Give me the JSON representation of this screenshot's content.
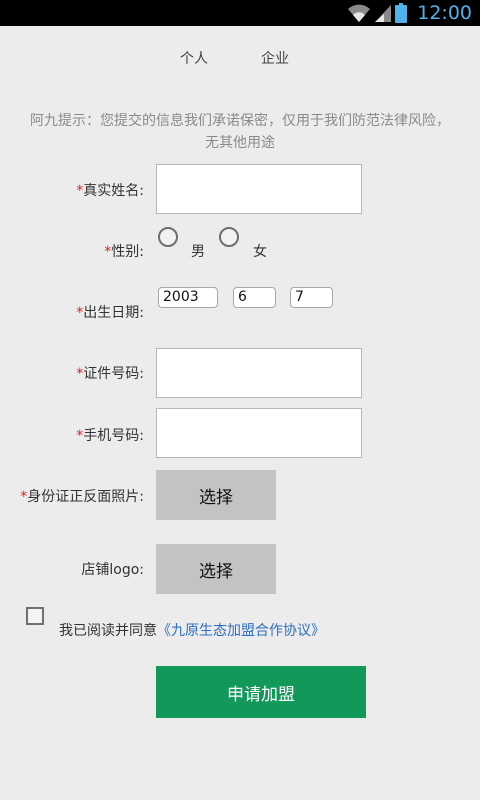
{
  "status_bar": {
    "time": "12:00",
    "icons": [
      "wifi-icon",
      "signal-icon",
      "battery-icon"
    ]
  },
  "tabs": [
    {
      "label": "个人"
    },
    {
      "label": "企业"
    }
  ],
  "tip": "阿九提示：您提交的信息我们承诺保密，仅用于我们防范法律风险，无其他用途",
  "form": {
    "required_mark": "*",
    "name_label": "真实姓名:",
    "gender_label": "性别:",
    "gender_options": [
      "男",
      "女"
    ],
    "birth_label": "出生日期:",
    "birth": {
      "year": "2003",
      "month": "6",
      "day": "7"
    },
    "id_label": "证件号码:",
    "phone_label": "手机号码:",
    "id_photo_label": "身份证正反面照片:",
    "logo_label": "店铺logo:",
    "choose_label": "选择"
  },
  "agreement": {
    "text": "我已阅读并同意",
    "link": "《九原生态加盟合作协议》"
  },
  "submit_label": "申请加盟",
  "colors": {
    "accent_green": "#12995a",
    "link_blue": "#2d6fc2",
    "required_red": "#e02020",
    "status_time": "#4fb3ea"
  }
}
